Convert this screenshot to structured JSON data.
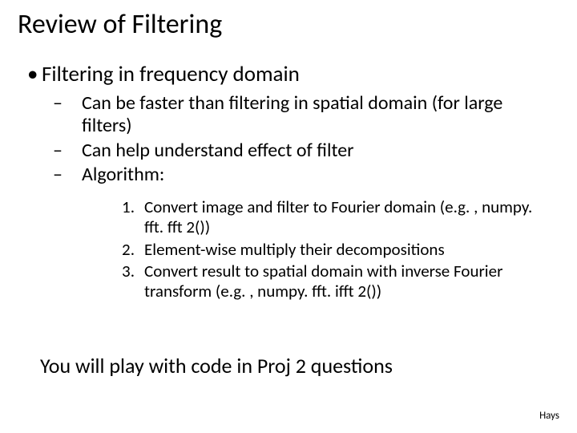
{
  "title": "Review of Filtering",
  "lvl1": {
    "bullet": "•",
    "text": "Filtering in frequency domain"
  },
  "lvl2": {
    "dash": "–",
    "items": [
      "Can be faster than filtering in spatial domain (for large filters)",
      "Can help understand effect of filter",
      "Algorithm:"
    ]
  },
  "olist": {
    "items": [
      {
        "n": "1.",
        "t": "Convert image and filter to Fourier domain (e.g. , numpy. fft. fft 2())"
      },
      {
        "n": "2.",
        "t": "Element-wise multiply their decompositions"
      },
      {
        "n": "3.",
        "t": "Convert result to spatial domain with inverse Fourier transform (e.g. , numpy. fft. ifft 2())"
      }
    ]
  },
  "closing": "You will play with code in Proj 2 questions",
  "credit": "Hays"
}
